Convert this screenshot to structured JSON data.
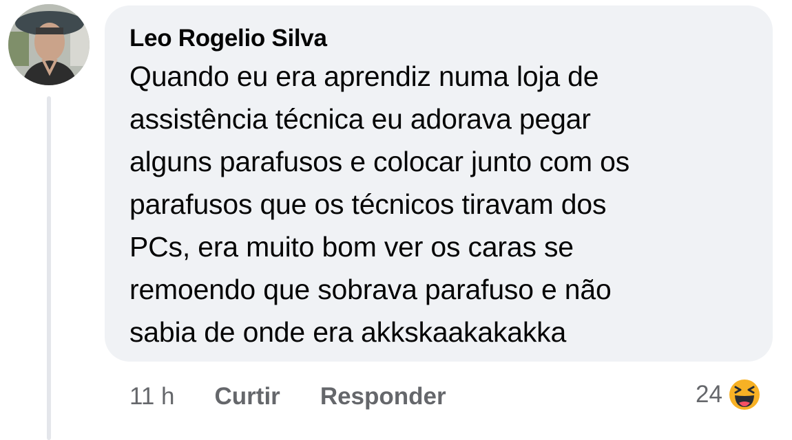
{
  "comment": {
    "author": "Leo Rogelio Silva",
    "text_lines": [
      "Quando eu era aprendiz numa loja de",
      "assistência técnica eu adorava pegar",
      "alguns parafusos e colocar junto com os",
      "parafusos que os técnicos tiravam dos",
      "PCs, era muito bom ver os caras se",
      "remoendo que sobrava parafuso e não",
      "sabia de onde era akkskaakakakka"
    ]
  },
  "actions": {
    "time": "11 h",
    "like_label": "Curtir",
    "reply_label": "Responder"
  },
  "reactions": {
    "count": "24",
    "icon": "haha-icon"
  },
  "colors": {
    "bubble_bg": "#f0f2f5",
    "meta_text": "#65676b",
    "thread_line": "#e4e6eb",
    "reaction_yellow": "#f7b125"
  }
}
